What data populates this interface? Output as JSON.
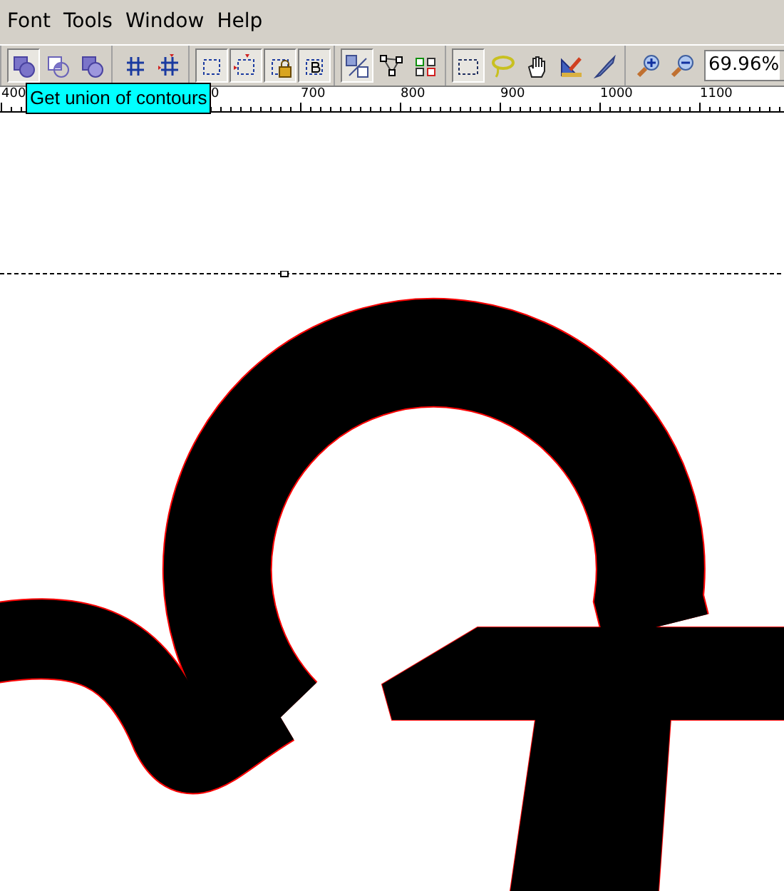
{
  "menu": [
    {
      "label": "Font"
    },
    {
      "label": "Tools"
    },
    {
      "label": "Window"
    },
    {
      "label": "Help"
    }
  ],
  "toolbar": {
    "groups": [
      {
        "tools": [
          {
            "kind": "union",
            "pressed": true
          },
          {
            "kind": "intersect",
            "pressed": false
          },
          {
            "kind": "exclude",
            "pressed": false
          }
        ]
      },
      {
        "tools": [
          {
            "kind": "grid",
            "pressed": false
          },
          {
            "kind": "grid-marker",
            "pressed": false
          }
        ]
      },
      {
        "tools": [
          {
            "kind": "guides",
            "pressed": true
          },
          {
            "kind": "guides-marker",
            "pressed": true
          },
          {
            "kind": "guides-lock",
            "pressed": true
          },
          {
            "kind": "guides-bold",
            "pressed": true
          }
        ]
      },
      {
        "tools": [
          {
            "kind": "slash",
            "pressed": true
          },
          {
            "kind": "nodes",
            "pressed": false
          },
          {
            "kind": "swap",
            "pressed": false
          }
        ]
      },
      {
        "tools": [
          {
            "kind": "select",
            "pressed": true
          },
          {
            "kind": "lasso",
            "pressed": false
          },
          {
            "kind": "hand",
            "pressed": false
          },
          {
            "kind": "measure",
            "pressed": false
          },
          {
            "kind": "knife",
            "pressed": false
          }
        ]
      },
      {
        "tools": [
          {
            "kind": "zoom-in",
            "pressed": false
          },
          {
            "kind": "zoom-out",
            "pressed": false
          }
        ]
      }
    ],
    "zoom": {
      "value": "69.96%"
    }
  },
  "tooltip": {
    "text": "Get union of contours"
  },
  "ruler": {
    "labels": [
      "400",
      "0",
      "700",
      "800",
      "900",
      "1000",
      "1100"
    ]
  }
}
